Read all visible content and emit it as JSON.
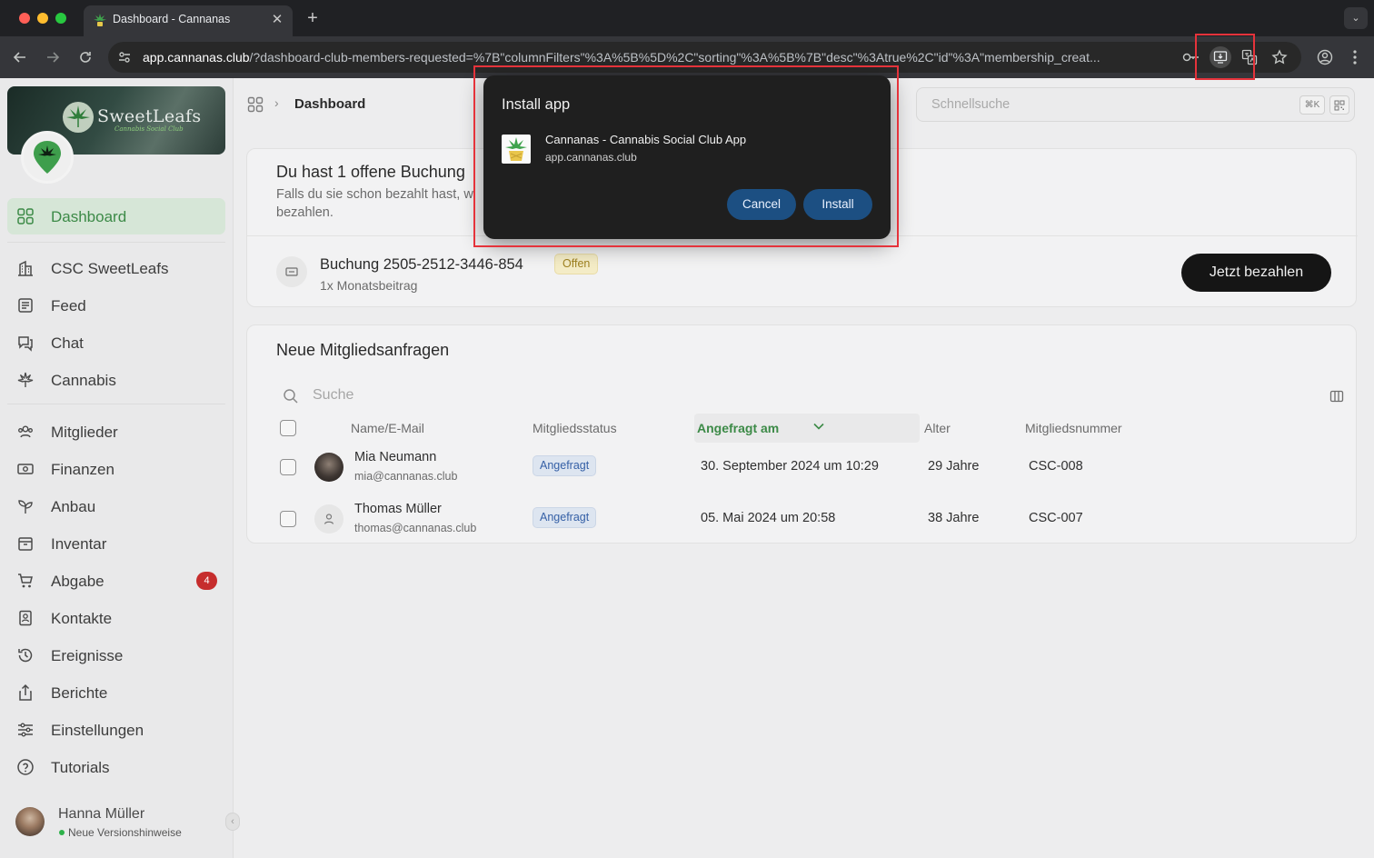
{
  "browser": {
    "tab_title": "Dashboard - Cannanas",
    "new_tab_label": "+",
    "url_host": "app.cannanas.club",
    "url_rest": "/?dashboard-club-members-requested=%7B\"columnFilters\"%3A%5B%5D%2C\"sorting\"%3A%5B%7B\"desc\"%3Atrue%2C\"id\"%3A\"membership_creat..."
  },
  "install_dialog": {
    "title": "Install app",
    "app_name": "Cannanas - Cannabis Social Club App",
    "app_host": "app.cannanas.club",
    "cancel_label": "Cancel",
    "install_label": "Install"
  },
  "sidebar": {
    "banner_title": "SweetLeafs",
    "banner_subtitle": "Cannabis Social Club",
    "items": [
      {
        "label": "Dashboard",
        "icon": "grid-icon",
        "active": true
      },
      {
        "label": "CSC SweetLeafs",
        "icon": "building-icon"
      },
      {
        "label": "Feed",
        "icon": "newspaper-icon"
      },
      {
        "label": "Chat",
        "icon": "chat-bubbles-icon"
      },
      {
        "label": "Cannabis",
        "icon": "leaf-icon"
      },
      {
        "label": "Mitglieder",
        "icon": "users-icon"
      },
      {
        "label": "Finanzen",
        "icon": "banknote-icon"
      },
      {
        "label": "Anbau",
        "icon": "sprout-icon"
      },
      {
        "label": "Inventar",
        "icon": "box-icon"
      },
      {
        "label": "Abgabe",
        "icon": "cart-icon",
        "badge": "4"
      },
      {
        "label": "Kontakte",
        "icon": "contact-book-icon"
      },
      {
        "label": "Ereignisse",
        "icon": "history-icon"
      },
      {
        "label": "Berichte",
        "icon": "share-icon"
      },
      {
        "label": "Einstellungen",
        "icon": "sliders-icon"
      },
      {
        "label": "Tutorials",
        "icon": "help-circle-icon"
      }
    ],
    "user": {
      "name": "Hanna Müller",
      "status": "Neue Versionshinweise"
    }
  },
  "header": {
    "breadcrumb": "Dashboard",
    "search_placeholder": "Schnellsuche",
    "search_shortcut": "⌘K"
  },
  "booking_card": {
    "title": "Du hast 1 offene Buchung",
    "description": "Falls du sie schon bezahlt hast, wi bezahlen.",
    "booking_id": "Buchung 2505-2512-3446-854",
    "status": "Offen",
    "detail": "1x Monatsbeitrag",
    "pay_label": "Jetzt bezahlen"
  },
  "requests_card": {
    "title": "Neue Mitgliedsanfragen",
    "search_placeholder": "Suche",
    "columns": [
      "Name/E-Mail",
      "Mitgliedsstatus",
      "Angefragt am",
      "Alter",
      "Mitgliedsnummer"
    ],
    "rows": [
      {
        "name": "Mia Neumann",
        "email": "mia@cannanas.club",
        "status": "Angefragt",
        "requested": "30. September 2024 um 10:29",
        "age": "29 Jahre",
        "number": "CSC-008"
      },
      {
        "name": "Thomas Müller",
        "email": "thomas@cannanas.club",
        "status": "Angefragt",
        "requested": "05. Mai 2024 um 20:58",
        "age": "38 Jahre",
        "number": "CSC-007"
      }
    ]
  },
  "colors": {
    "accent_green": "#3c8a47",
    "dialog_button": "#1c4f82",
    "badge_red": "#c62d2d",
    "highlight": "#e5333b"
  }
}
